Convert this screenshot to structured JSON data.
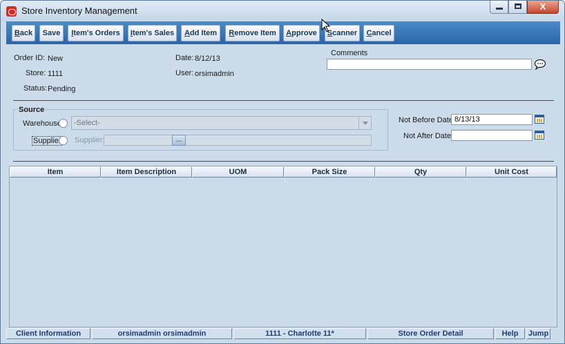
{
  "window": {
    "title": "Store Inventory Management",
    "minimize_icon": "minimize-icon",
    "maximize_icon": "maximize-icon",
    "close_icon": "close-icon",
    "close_glyph": "X"
  },
  "toolbar": {
    "buttons": [
      {
        "label": "Back",
        "mnemonic": "B",
        "rest": "ack"
      },
      {
        "label": "Save",
        "mnemonic": "",
        "rest": "Save"
      },
      {
        "label": "Item's Orders",
        "mnemonic": "I",
        "rest": "tem's Orders"
      },
      {
        "label": "Item's Sales",
        "mnemonic": "I",
        "rest": "tem's Sales"
      },
      {
        "label": "Add Item",
        "mnemonic": "A",
        "rest": "dd Item"
      },
      {
        "label": "Remove Item",
        "mnemonic": "R",
        "rest": "emove Item"
      },
      {
        "label": "Approve",
        "mnemonic": "A",
        "rest": "pprove"
      },
      {
        "label": "Scanner",
        "mnemonic": "S",
        "rest": "canner"
      },
      {
        "label": "Cancel",
        "mnemonic": "C",
        "rest": "ancel"
      }
    ]
  },
  "order": {
    "order_id_label": "Order ID:",
    "order_id_value": "New",
    "store_label": "Store:",
    "store_value": "1111",
    "status_label": "Status:",
    "status_value": "Pending",
    "date_label": "Date:",
    "date_value": "8/12/13",
    "user_label": "User:",
    "user_value": "orsimadmin",
    "comments_label": "Comments",
    "comments_value": ""
  },
  "source": {
    "title": "Source",
    "warehouse_label": "Warehouse",
    "warehouse_select": "-Select-",
    "supplier_label": "Supplier",
    "supplier_field_label": "Supplier:",
    "supplier_value": "",
    "lookup_button": "..."
  },
  "dates": {
    "not_before_label": "Not Before Date:",
    "not_before_value": "8/13/13",
    "not_after_label": "Not After Date:",
    "not_after_value": ""
  },
  "table": {
    "columns": [
      "Item",
      "Item Description",
      "UOM",
      "Pack Size",
      "Qty",
      "Unit Cost"
    ],
    "rows": []
  },
  "statusbar": {
    "client_info": "Client Information",
    "user": "orsimadmin orsimadmin",
    "store": "1111 - Charlotte 11*",
    "screen": "Store Order Detail",
    "help": "Help",
    "jump": "Jump"
  },
  "colors": {
    "toolbar": "#2b66a8",
    "background": "#cbdbea",
    "status_text": "#1f3c73"
  }
}
